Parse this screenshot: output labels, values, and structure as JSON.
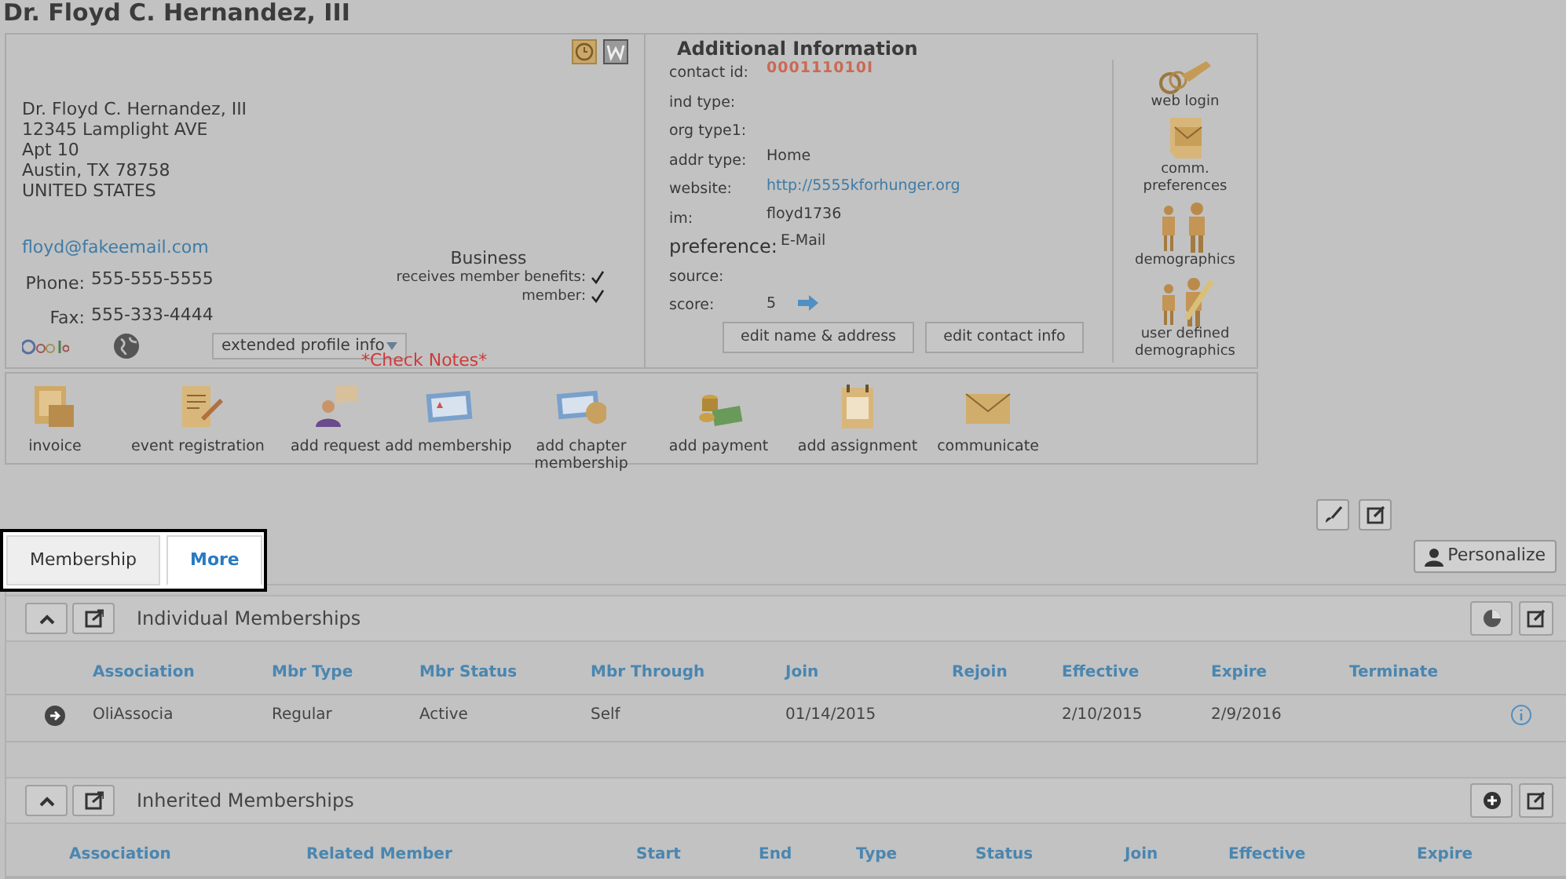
{
  "page_title": "Dr. Floyd C. Hernandez, III",
  "contact_card": {
    "address_lines": [
      "Dr. Floyd C. Hernandez, III",
      "12345 Lamplight AVE",
      "Apt 10",
      "Austin, TX 78758",
      "UNITED STATES"
    ],
    "email": "floyd@fakeemail.com",
    "phones": [
      {
        "label": "Phone:",
        "value": "555-555-5555"
      },
      {
        "label": "Fax:",
        "value": "555-333-4444"
      }
    ],
    "business": {
      "heading": "Business",
      "flags": [
        {
          "label": "receives member benefits:",
          "checked": true
        },
        {
          "label": "member:",
          "checked": true
        }
      ]
    },
    "extended_button": "extended profile info",
    "notice": "*Check Notes*"
  },
  "additional_info": {
    "title": "Additional Information",
    "fields": [
      {
        "label": "contact id:",
        "value": "000111010I",
        "kind": "code"
      },
      {
        "label": "ind type:"
      },
      {
        "label": "org type1:"
      },
      {
        "label": "addr type:",
        "value": "Home",
        "kind": "text"
      },
      {
        "label": "website:",
        "value": "http://5555kforhunger.org",
        "kind": "link"
      },
      {
        "label": "im:",
        "value": "floyd1736",
        "kind": "text"
      },
      {
        "label": "preference:",
        "value": "E-Mail",
        "kind": "text",
        "emphasis": true
      },
      {
        "label": "source:"
      },
      {
        "label": "score:",
        "value": "5",
        "kind": "score"
      }
    ],
    "buttons": [
      "edit name & address",
      "edit contact info"
    ]
  },
  "side_links": [
    {
      "label": "web login"
    },
    {
      "label": "comm. preferences"
    },
    {
      "label": "demographics"
    },
    {
      "label": "user defined demographics"
    }
  ],
  "actions": [
    {
      "label": "invoice"
    },
    {
      "label": "event registration"
    },
    {
      "label": "add request"
    },
    {
      "label": "add membership"
    },
    {
      "label": "add chapter membership"
    },
    {
      "label": "add payment"
    },
    {
      "label": "add assignment"
    },
    {
      "label": "communicate"
    }
  ],
  "tabs": [
    {
      "label": "Membership",
      "selected": false
    },
    {
      "label": "More",
      "selected": true
    }
  ],
  "personalize_button": "Personalize",
  "sections": [
    {
      "title": "Individual Memberships",
      "columns": [
        "Association",
        "Mbr Type",
        "Mbr Status",
        "Mbr Through",
        "Join",
        "Rejoin",
        "Effective",
        "Expire",
        "Terminate"
      ],
      "rows": [
        {
          "cells": [
            "OliAssocia",
            "Regular",
            "Active",
            "Self",
            "01/14/2015",
            "",
            "2/10/2015",
            "2/9/2016",
            ""
          ]
        }
      ]
    },
    {
      "title": "Inherited Memberships",
      "columns": [
        "Association",
        "Related Member",
        "Start",
        "End",
        "Type",
        "Status",
        "Join",
        "Effective",
        "Expire"
      ]
    }
  ]
}
